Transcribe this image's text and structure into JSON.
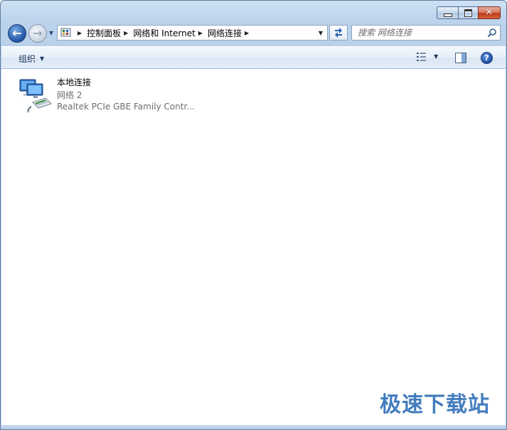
{
  "window": {
    "caption_buttons": {
      "minimize": "minimize",
      "maximize": "maximize",
      "close": "✕"
    }
  },
  "navigation": {
    "back_icon": "back-arrow-icon",
    "forward_icon": "forward-arrow-icon",
    "breadcrumbs": [
      "控制面板",
      "网络和 Internet",
      "网络连接"
    ]
  },
  "search": {
    "placeholder": "搜索 网络连接"
  },
  "command_bar": {
    "organize_label": "组织",
    "help_label": "?"
  },
  "connections": [
    {
      "name": "本地连接",
      "network": "网络  2",
      "device": "Realtek PCIe GBE Family Contr..."
    }
  ],
  "watermark": "极速下载站",
  "colors": {
    "accent": "#2f6fb7",
    "window_frame": "#bcd3ec",
    "secondary_text": "#6d6d6d"
  }
}
